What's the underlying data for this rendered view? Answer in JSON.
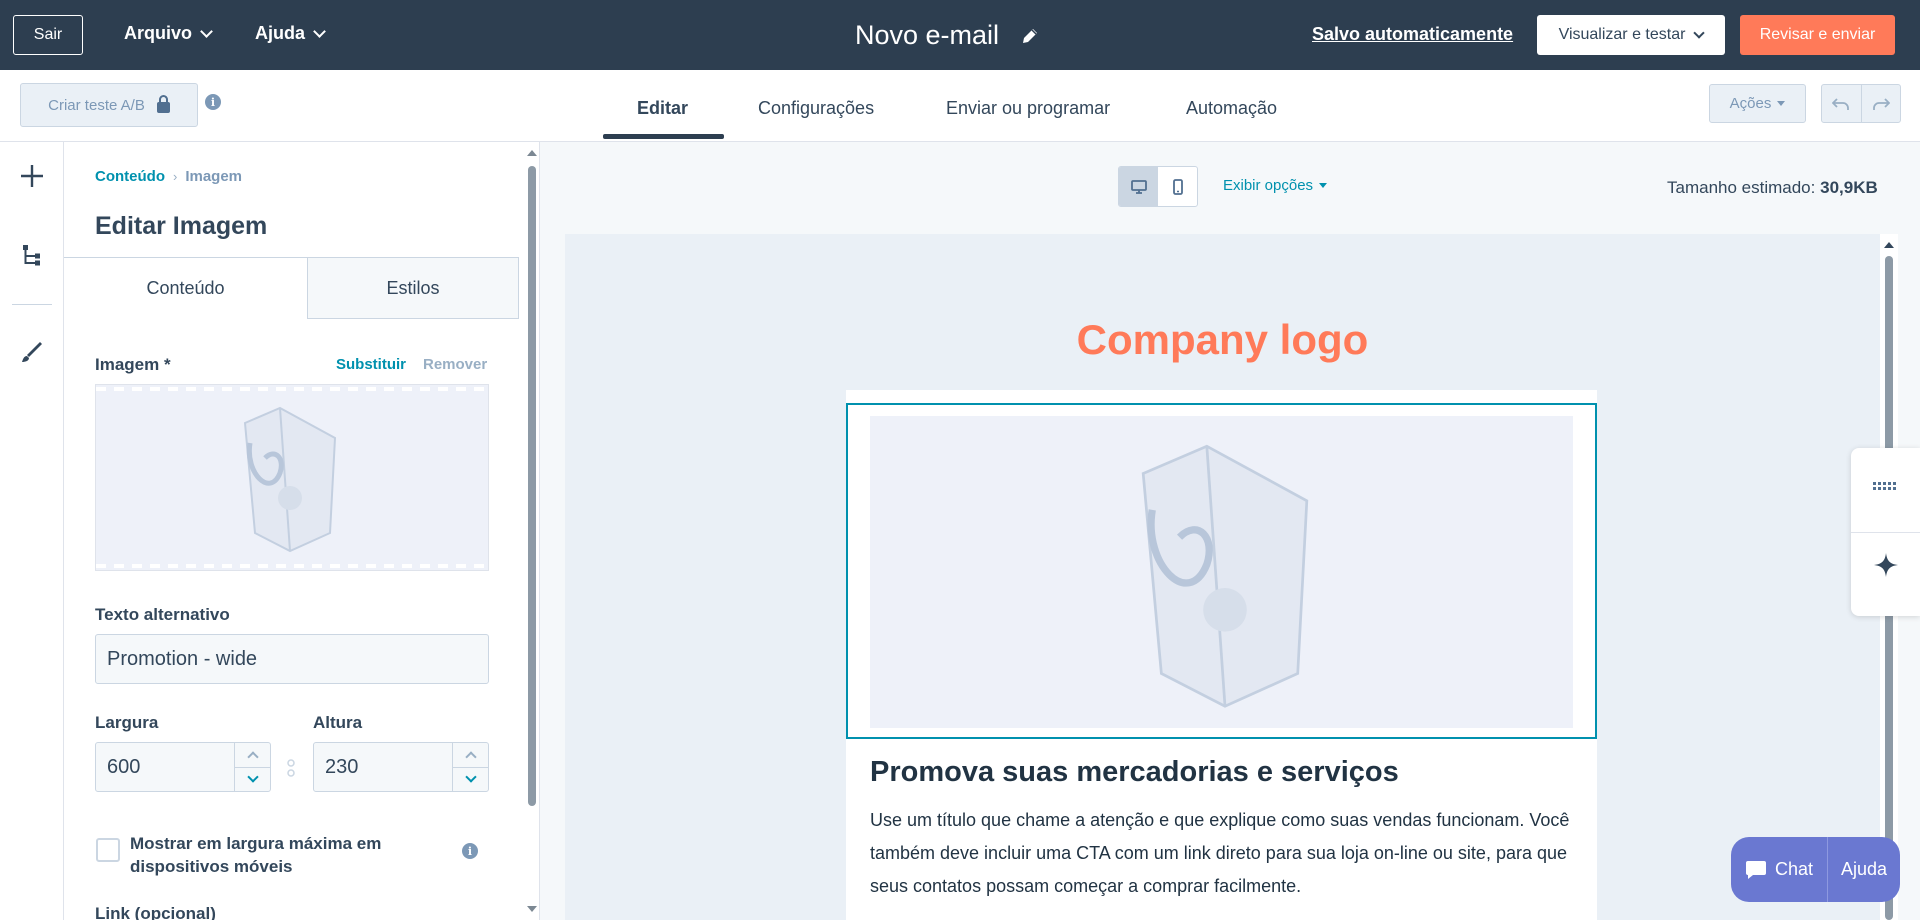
{
  "topbar": {
    "exit_label": "Sair",
    "menu_file": "Arquivo",
    "menu_help": "Ajuda",
    "doc_title": "Novo e-mail",
    "autosave": "Salvo automaticamente",
    "preview_label": "Visualizar e testar",
    "review_label": "Revisar e enviar"
  },
  "toolbar": {
    "ab_test_label": "Criar teste A/B",
    "tabs": [
      {
        "label": "Editar",
        "active": true
      },
      {
        "label": "Configurações",
        "active": false
      },
      {
        "label": "Enviar ou programar",
        "active": false
      },
      {
        "label": "Automação",
        "active": false
      }
    ],
    "actions_label": "Ações"
  },
  "panel": {
    "breadcrumb_parent": "Conteúdo",
    "breadcrumb_current": "Imagem",
    "title": "Editar Imagem",
    "tabs": [
      {
        "label": "Conteúdo",
        "active": true
      },
      {
        "label": "Estilos",
        "active": false
      }
    ],
    "image_label": "Imagem *",
    "replace_label": "Substituir",
    "remove_label": "Remover",
    "alt_label": "Texto alternativo",
    "alt_value": "Promotion - wide",
    "width_label": "Largura",
    "width_value": "600",
    "height_label": "Altura",
    "height_value": "230",
    "checkbox_label": "Mostrar em largura máxima em dispositivos móveis",
    "link_label": "Link (opcional)"
  },
  "canvas": {
    "display_options": "Exibir opções",
    "est_size_label": "Tamanho estimado:",
    "est_size_value": "30,9KB",
    "logo_text": "Company logo",
    "heading": "Promova suas mercadorias e serviços",
    "paragraph": "Use um título que chame a atenção e que explique como suas vendas funcionam. Você também deve incluir uma CTA com um link direto para sua loja on-line ou site, para que seus contatos possam começar a comprar facilmente."
  },
  "chat": {
    "chat_label": "Chat",
    "help_label": "Ajuda"
  },
  "colors": {
    "topbar": "#2d3e50",
    "accent_orange": "#ff7a59",
    "accent_teal": "#0091ae",
    "chat": "#6a78d1"
  }
}
